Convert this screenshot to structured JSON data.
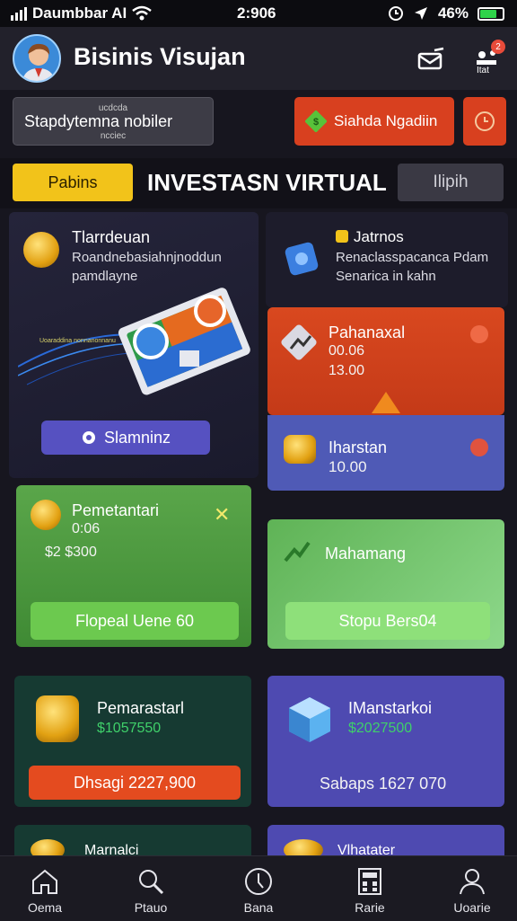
{
  "status_bar": {
    "carrier": "Daumbbar AI",
    "time": "2:906",
    "battery": "46%"
  },
  "header": {
    "title": "Bisinis Visujan",
    "notif_badge": "2",
    "notif_label": "Itat"
  },
  "banner": {
    "line_top": "ucdcda",
    "line_main": "Stapdytemna nobiler",
    "line_bottom": "ncciec"
  },
  "cta": {
    "label": "Siahda Ngadiin"
  },
  "tabs": {
    "active": "Pabins",
    "section_title": "INVESTASN VIRTUAL",
    "right": "Ilipih"
  },
  "left_top": {
    "title": "Tlarrdeuan",
    "desc_1": "Roandnebasiahnjnoddun",
    "desc_2": "pamdlayne",
    "button": "Slamninz",
    "chart_caption": "Uoaraddina nonnanonnanu"
  },
  "right_top": {
    "title": "Jatrnos",
    "desc_1": "Renaclasspacanca Pdam",
    "desc_2": "Senarica in kahn"
  },
  "orange_card": {
    "title": "Pahanaxal",
    "val_1": "00.06",
    "val_2": "13.00"
  },
  "blue_card": {
    "title": "Iharstan",
    "value": "10.00"
  },
  "green_card_left": {
    "title": "Pemetantari",
    "val_1": "0:06",
    "val_2": "$2  $300",
    "button": "Flopeal Uene 60"
  },
  "green_card_right": {
    "title": "Mahamang",
    "button": "Stopu Bers04"
  },
  "dark_card": {
    "title": "Pemarastarl",
    "amount": "$1057550",
    "button": "Dhsagi 2227,900"
  },
  "purple_card": {
    "title": "IManstarkoi",
    "amount": "$2027500",
    "footer": "Sabaps 1627 070"
  },
  "peek_left": {
    "title": "Marnalci"
  },
  "peek_right": {
    "title": "Vlhatater"
  },
  "nav": [
    {
      "label": "Oema",
      "icon": "home-icon"
    },
    {
      "label": "Ptauo",
      "icon": "search-icon"
    },
    {
      "label": "Bana",
      "icon": "clock-icon"
    },
    {
      "label": "Rarie",
      "icon": "calculator-icon"
    },
    {
      "label": "Uoarie",
      "icon": "user-icon"
    }
  ],
  "colors": {
    "accent_yellow": "#f2c31a",
    "orange": "#d8401f",
    "green": "#57a347",
    "purple": "#5956b8",
    "bg": "#17161f"
  }
}
